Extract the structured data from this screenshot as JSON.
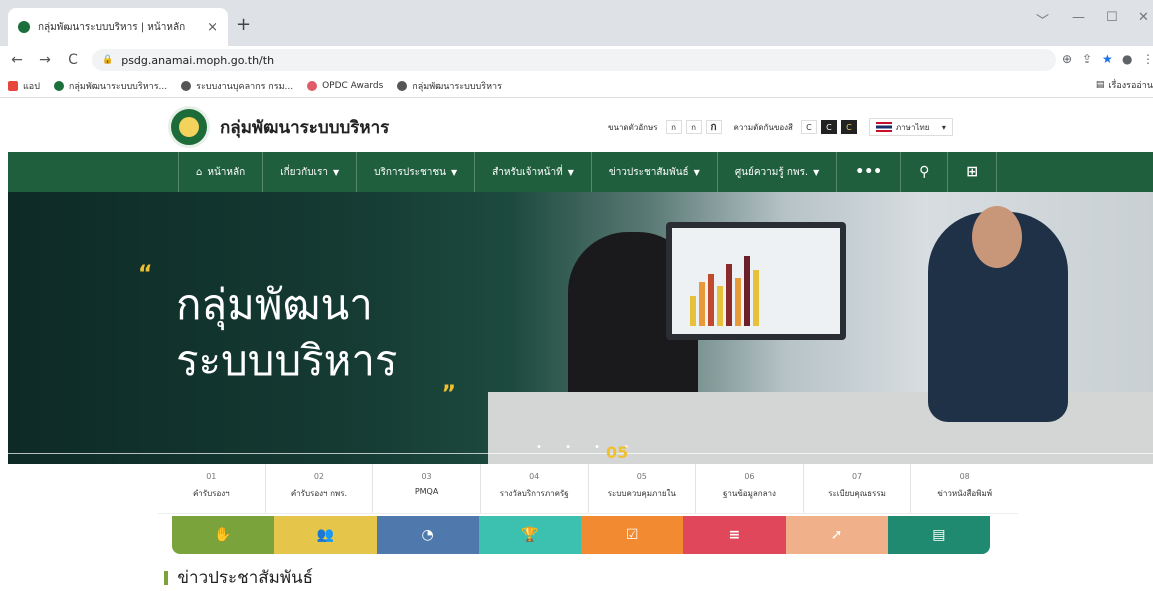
{
  "browser": {
    "tab_title": "กลุ่มพัฒนาระบบบริหาร | หน้าหลัก",
    "tab_close": "×",
    "new_tab": "+",
    "url": "psdg.anamai.moph.go.th/th",
    "back": "←",
    "forward": "→",
    "reload": "C",
    "window_controls": [
      "﹀",
      "—",
      "☐",
      "✕"
    ],
    "bookmarks": [
      {
        "label": "แอป",
        "color": "#e8453c"
      },
      {
        "label": "กลุ่มพัฒนาระบบบริหาร...",
        "color": "#1b6f3a"
      },
      {
        "label": "ระบบงานบุคลากร กรม...",
        "color": "#555555"
      },
      {
        "label": "OPDC Awards",
        "color": "#e05a6a"
      },
      {
        "label": "กลุ่มพัฒนาระบบบริหาร",
        "color": "#555555"
      }
    ],
    "reading_list": "เรื่องรออ่าน"
  },
  "header": {
    "site_title": "กลุ่มพัฒนาระบบบริหาร",
    "font_size_label": "ขนาดตัวอักษร",
    "font_sizes": [
      "ก",
      "ก",
      "ก"
    ],
    "contrast_label": "ความตัดกันของสี",
    "contrast_options": [
      "C",
      "C",
      "C"
    ],
    "language": "ภาษาไทย",
    "lang_chevron": "▾"
  },
  "nav": {
    "items": [
      {
        "label": "หน้าหลัก",
        "icon": "🏠",
        "dropdown": false
      },
      {
        "label": "เกี่ยวกับเรา",
        "dropdown": true
      },
      {
        "label": "บริการประชาชน",
        "dropdown": true
      },
      {
        "label": "สำหรับเจ้าหน้าที่",
        "dropdown": true
      },
      {
        "label": "ข่าวประชาสัมพันธ์",
        "dropdown": true
      },
      {
        "label": "ศูนย์ความรู้ กพร.",
        "dropdown": true
      }
    ],
    "more_icon": "•••",
    "search_icon": "🔍",
    "sitemap_icon": "品",
    "chevron": "⌄"
  },
  "hero": {
    "open_quote": "“",
    "line1": "กลุ่มพัฒนา",
    "line2": "ระบบบริหาร",
    "close_quote": "„",
    "slide_dots": "• • • •",
    "slide_number": "05"
  },
  "steps": [
    {
      "num": "01",
      "label": "คำรับรองฯ"
    },
    {
      "num": "02",
      "label": "คำรับรองฯ กพร."
    },
    {
      "num": "03",
      "label": "PMQA"
    },
    {
      "num": "04",
      "label": "รางวัลบริการภาครัฐ"
    },
    {
      "num": "05",
      "label": "ระบบควบคุมภายใน"
    },
    {
      "num": "06",
      "label": "ฐานข้อมูลกลาง"
    },
    {
      "num": "07",
      "label": "ระเบียบคุณธรรม"
    },
    {
      "num": "08",
      "label": "ข่าวหนังสือพิมพ์"
    }
  ],
  "tiles": [
    {
      "icon": "handshake-icon",
      "glyph": "✋",
      "color": "#7aa33b"
    },
    {
      "icon": "users-icon",
      "glyph": "👥",
      "color": "#e5c64a"
    },
    {
      "icon": "pie-chart-icon",
      "glyph": "◔",
      "color": "#4f78ad"
    },
    {
      "icon": "trophy-icon",
      "glyph": "🏆",
      "color": "#3cc0b0"
    },
    {
      "icon": "calendar-check-icon",
      "glyph": "☑",
      "color": "#f28a32"
    },
    {
      "icon": "database-icon",
      "glyph": "≡",
      "color": "#e0475b"
    },
    {
      "icon": "arrow-icon",
      "glyph": "➚",
      "color": "#f0b08a"
    },
    {
      "icon": "news-icon",
      "glyph": "▤",
      "color": "#1f8a6f"
    }
  ],
  "news": {
    "title": "ข่าวประชาสัมพันธ์"
  }
}
